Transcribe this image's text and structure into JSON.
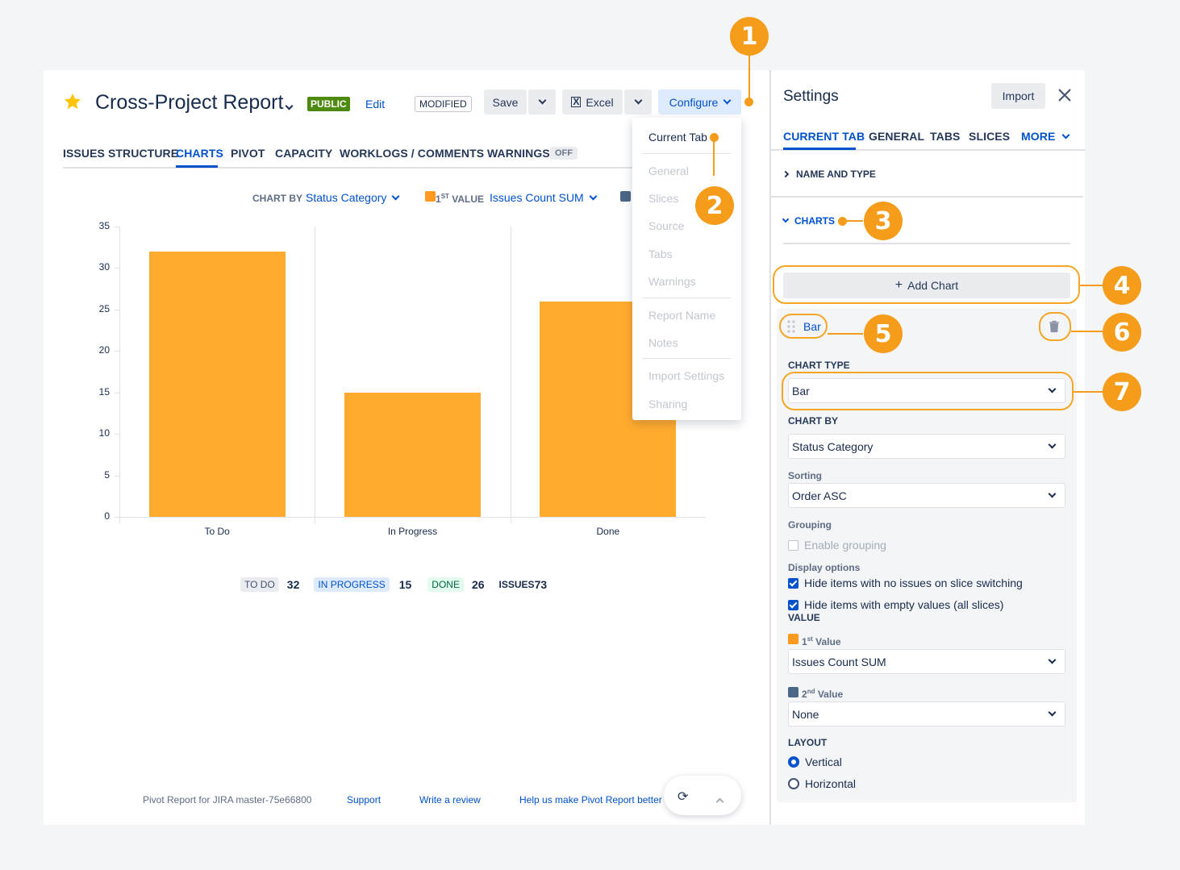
{
  "header": {
    "title": "Cross-Project Report",
    "public_badge": "PUBLIC",
    "edit_label": "Edit",
    "modified_badge": "MODIFIED",
    "save_label": "Save",
    "excel_label": "Excel",
    "configure_label": "Configure"
  },
  "tabs": [
    "ISSUES STRUCTURE",
    "CHARTS",
    "PIVOT",
    "CAPACITY",
    "WORKLOGS / COMMENTS",
    "WARNINGS"
  ],
  "warnings_badge": "OFF",
  "chart_controls": {
    "chart_by_label": "CHART BY",
    "chart_by_value": "Status Category",
    "value_label_sup": "ST",
    "value_label_pre": "1",
    "value_label": "VALUE",
    "value_value": "Issues Count SUM"
  },
  "configure_menu": {
    "items": [
      "Current Tab",
      "General",
      "Slices",
      "Source",
      "Tabs",
      "Warnings",
      "Report Name",
      "Notes",
      "Import Settings",
      "Sharing"
    ]
  },
  "chart_data": {
    "type": "bar",
    "categories": [
      "To Do",
      "In Progress",
      "Done"
    ],
    "values": [
      32,
      15,
      26
    ],
    "ylim": [
      0,
      35
    ],
    "yticks": [
      0,
      5,
      10,
      15,
      20,
      25,
      30,
      35
    ],
    "colors": {
      "bar": "#FFAB2E"
    }
  },
  "summary": {
    "todo_label": "TO DO",
    "todo_count": "32",
    "inprogress_label": "IN PROGRESS",
    "inprogress_count": "15",
    "done_label": "DONE",
    "done_count": "26",
    "issues_label": "ISSUES",
    "issues_count": "73"
  },
  "footer": {
    "version": "Pivot Report for JIRA master-75e66800",
    "support": "Support",
    "review": "Write a review",
    "help": "Help us make Pivot Report better"
  },
  "settings": {
    "title": "Settings",
    "import_label": "Import",
    "tabs": [
      "CURRENT TAB",
      "GENERAL",
      "TABS",
      "SLICES",
      "MORE"
    ],
    "name_and_type": "NAME AND TYPE",
    "charts_section": "CHARTS",
    "add_chart": "Add Chart",
    "chart_item": "Bar",
    "chart_type_label": "CHART TYPE",
    "chart_type_value": "Bar",
    "chart_by_label": "CHART BY",
    "chart_by_value": "Status Category",
    "sorting_label": "Sorting",
    "sorting_value": "Order ASC",
    "grouping_label": "Grouping",
    "enable_grouping": "Enable grouping",
    "display_options_label": "Display options",
    "hide_no_issues": "Hide items with no issues on slice switching",
    "hide_empty": "Hide items with empty values (all slices)",
    "value_label": "VALUE",
    "first_value_pre": "1",
    "first_value_sup": "st",
    "first_value_label": "Value",
    "first_value": "Issues Count SUM",
    "second_value_pre": "2",
    "second_value_sup": "nd",
    "second_value_label": "Value",
    "second_value": "None",
    "layout_label": "LAYOUT",
    "layout_vertical": "Vertical",
    "layout_horizontal": "Horizontal"
  },
  "callouts": [
    "1",
    "2",
    "3",
    "4",
    "5",
    "6",
    "7"
  ],
  "colors": {
    "accent": "#0052CC",
    "callout": "#F59C1A",
    "public_badge": "#4F8A10",
    "first_value_swatch": "#FF991F",
    "second_value_swatch": "#4A6785"
  }
}
